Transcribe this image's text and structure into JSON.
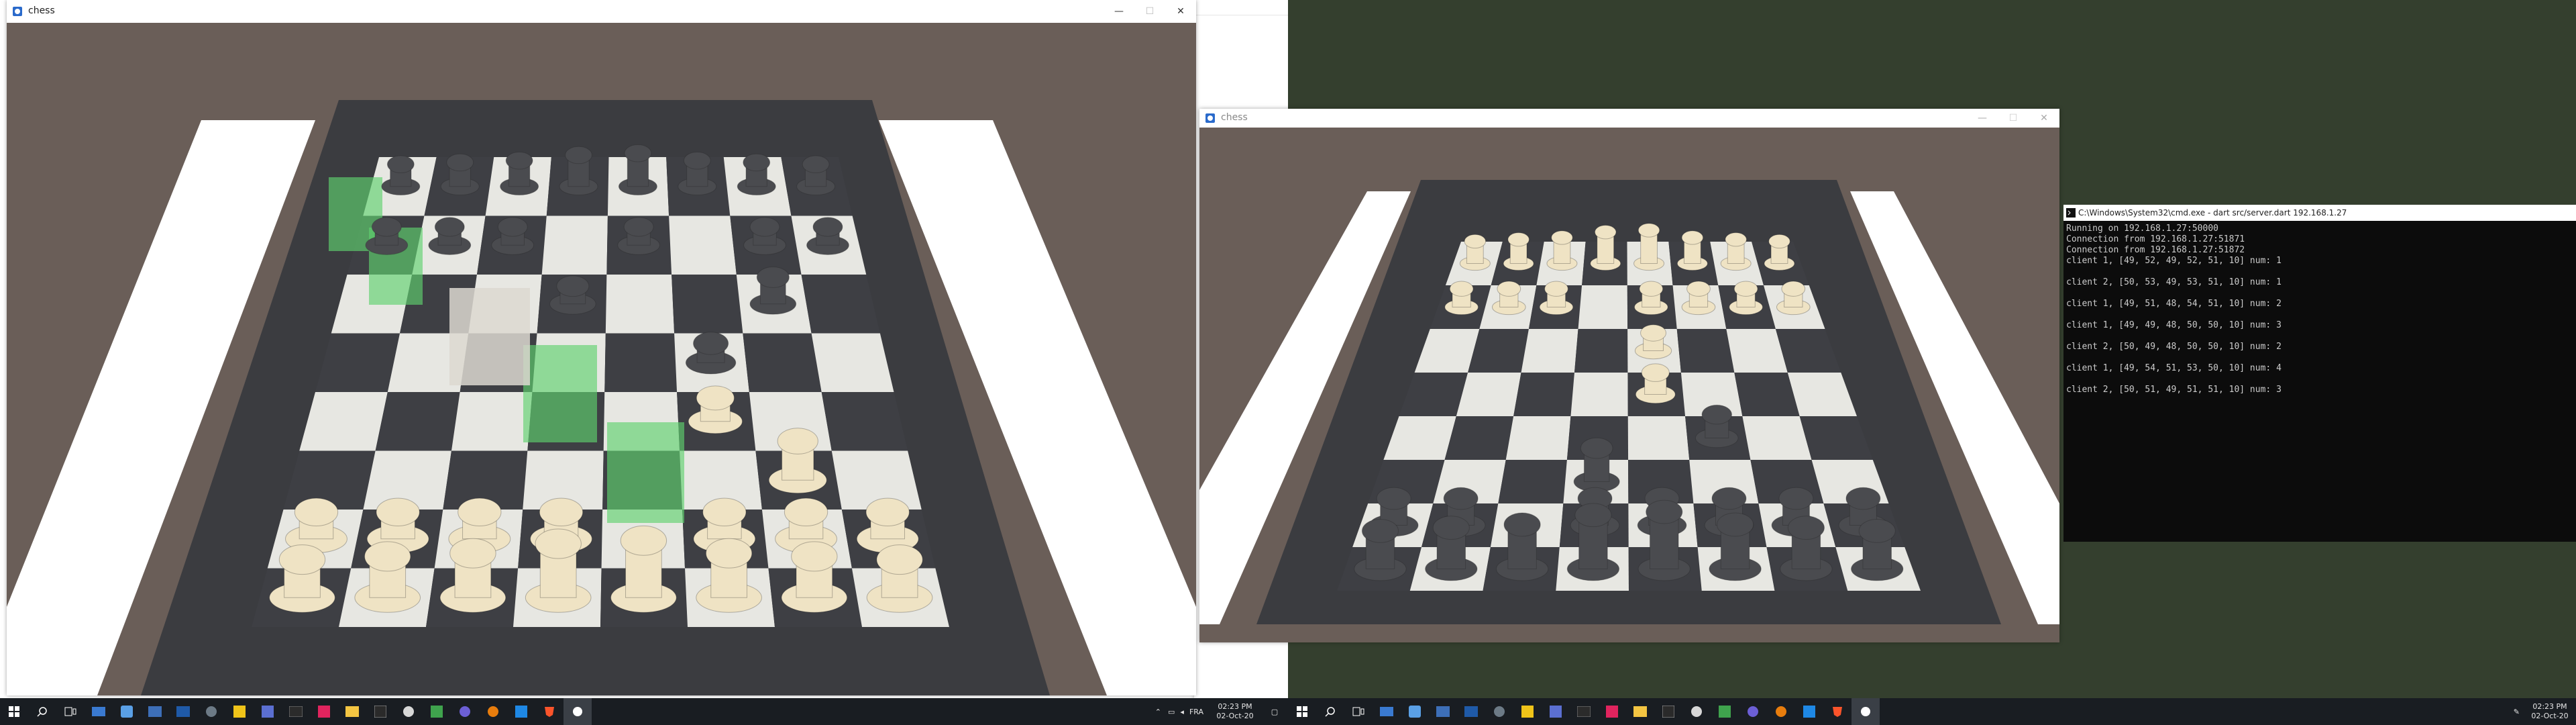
{
  "left_window": {
    "title": "chess",
    "minimize": "—",
    "maximize": "☐",
    "close": "✕"
  },
  "right_window": {
    "title": "chess",
    "minimize": "—",
    "maximize": "☐",
    "close": "✕"
  },
  "terminal": {
    "title": "C:\\Windows\\System32\\cmd.exe - dart  src/server.dart 192.168.1.27",
    "lines": [
      "Running on 192.168.1.27:50000",
      "Connection from 192.168.1.27:51871",
      "Connection from 192.168.1.27:51872",
      "client 1, [49, 52, 49, 52, 51, 10] num: 1",
      "",
      "client 2, [50, 53, 49, 53, 51, 10] num: 1",
      "",
      "client 1, [49, 51, 48, 54, 51, 10] num: 2",
      "",
      "client 1, [49, 49, 48, 50, 50, 10] num: 3",
      "",
      "client 2, [50, 49, 48, 50, 50, 10] num: 2",
      "",
      "client 1, [49, 54, 51, 53, 50, 10] num: 4",
      "",
      "client 2, [50, 51, 49, 51, 51, 10] num: 3"
    ]
  },
  "taskbar_left": {
    "lang": "FRA",
    "time": "02:23 PM",
    "date": "02-Oct-20"
  },
  "taskbar_right": {
    "time": "02:23 PM",
    "date": "02-Oct-20"
  },
  "colors": {
    "board_dark": "#3e3f44",
    "board_light": "#e7e7e2",
    "white_piece": "#efe3c4",
    "black_piece": "#4a4b4f",
    "highlight": "#5fd16f",
    "room": "#6a5e58"
  },
  "icons": [
    "windows-start-icon",
    "search-icon",
    "task-view-icon",
    "file-explorer-icon",
    "vscode-icon",
    "brave-icon",
    "chess-app-icon"
  ]
}
